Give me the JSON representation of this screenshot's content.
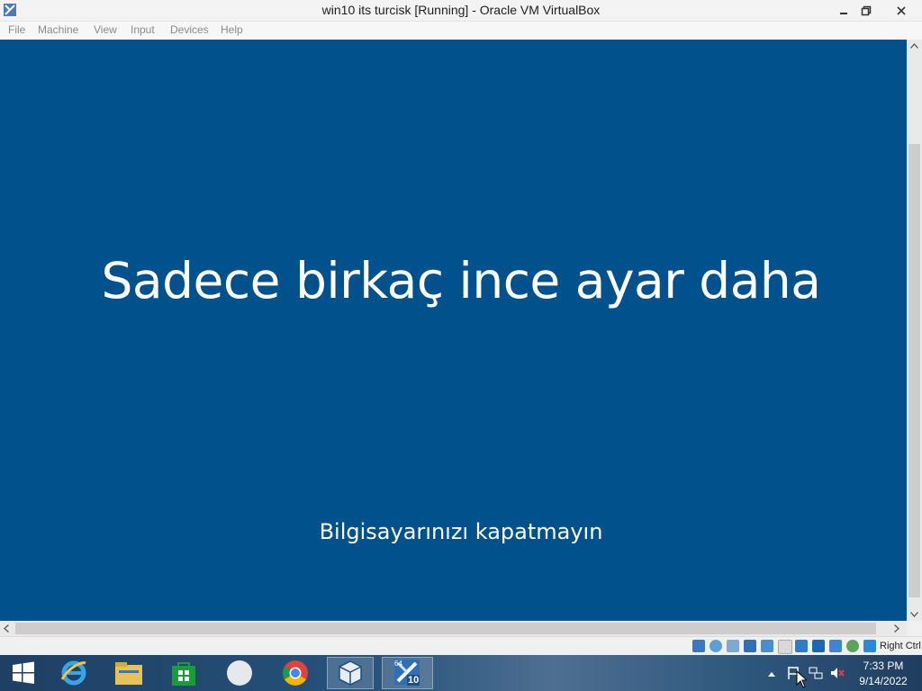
{
  "window": {
    "title": "win10 its turcisk [Running] - Oracle VM VirtualBox"
  },
  "menu": {
    "items": [
      "File",
      "Machine",
      "View",
      "Input",
      "Devices",
      "Help"
    ]
  },
  "guest_screen": {
    "heading": "Sadece birkaç ince ayar daha",
    "subtext": "Bilgisayarınızı kapatmayın",
    "background_color": "#00518c"
  },
  "statusbar": {
    "host_key": "Right Ctrl",
    "icons": [
      "hard-disk-icon",
      "optical-drive-icon",
      "audio-icon",
      "network-icon",
      "usb-icon",
      "shared-folders-icon",
      "display-icon",
      "video-capture-icon",
      "recording-icon",
      "cpu-icon",
      "guest-additions-icon",
      "mouse-integration-icon"
    ]
  },
  "taskbar": {
    "apps": [
      "start-icon",
      "internet-explorer-icon",
      "file-explorer-icon",
      "store-icon",
      "blank-app-icon",
      "chrome-icon",
      "virtualbox-icon",
      "vm-win10-icon"
    ],
    "vm_badge": "10",
    "vm_badge_top": "64",
    "time": "7:33 PM",
    "date": "9/14/2022"
  }
}
